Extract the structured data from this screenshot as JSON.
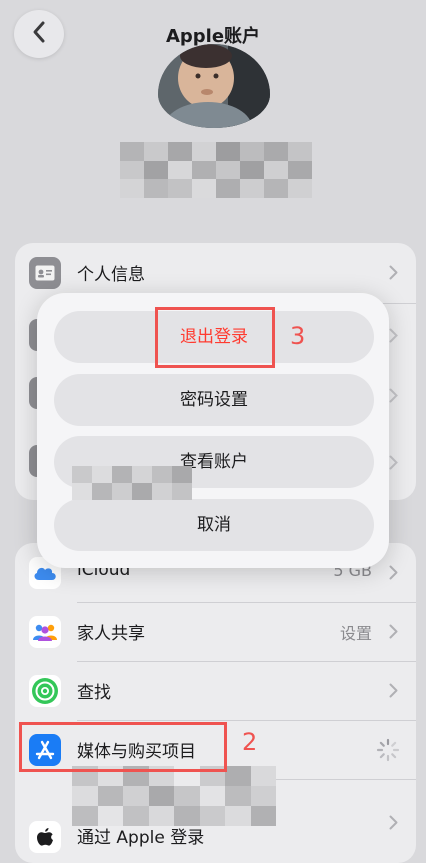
{
  "header": {
    "title": "Apple账户",
    "back_icon": "chevron-left-icon"
  },
  "section1": {
    "items": [
      {
        "label": "个人信息",
        "icon": "id-card-icon"
      }
    ]
  },
  "section2": {
    "items": [
      {
        "label": "iCloud",
        "value": "5 GB",
        "icon": "icloud-icon"
      },
      {
        "label": "家人共享",
        "value": "设置",
        "icon": "family-icon"
      },
      {
        "label": "查找",
        "icon": "find-my-icon"
      },
      {
        "label": "媒体与购买项目",
        "icon": "app-store-icon"
      },
      {
        "label": "通过 Apple 登录",
        "icon": "apple-icon"
      }
    ]
  },
  "popup": {
    "buttons": [
      "退出登录",
      "密码设置",
      "查看账户",
      "取消"
    ]
  },
  "annotations": {
    "step3": "3",
    "step2": "2"
  },
  "colors": {
    "annotation_red": "#ef5350",
    "signout_red": "#ff3b30",
    "icloud_blue": "#3d8cf0",
    "appstore_blue": "#1a7cf5",
    "findmy_green": "#34c759"
  }
}
